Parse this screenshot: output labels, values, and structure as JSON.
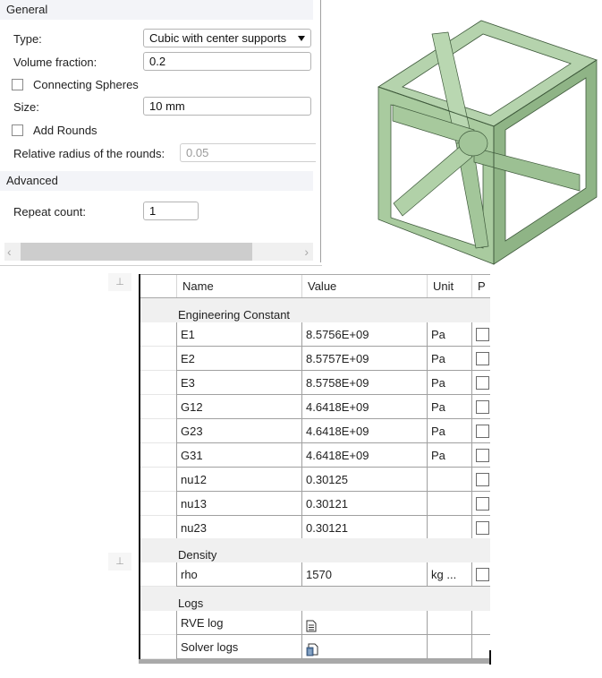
{
  "settings": {
    "general_header": "General",
    "type_label": "Type:",
    "type_value": "Cubic with center supports",
    "volume_fraction_label": "Volume fraction:",
    "volume_fraction_value": "0.2",
    "connecting_spheres_label": "Connecting Spheres",
    "connecting_spheres_checked": false,
    "size_label": "Size:",
    "size_value": "10 mm",
    "add_rounds_label": "Add Rounds",
    "add_rounds_checked": false,
    "round_radius_label": "Relative radius of the rounds:",
    "round_radius_value": "0.05",
    "advanced_header": "Advanced",
    "repeat_count_label": "Repeat count:",
    "repeat_count_value": "1",
    "scroll_left_icon": "chevron-left-icon",
    "scroll_right_icon": "chevron-right-icon"
  },
  "viewport": {
    "model": "cubic lattice unit cell with center supports",
    "model_color": "#a8c9a0"
  },
  "grid": {
    "columns": [
      "Name",
      "Value",
      "Unit",
      "P"
    ],
    "groups": [
      {
        "label": "Engineering Constant",
        "rows": [
          {
            "name": "E1",
            "value": "8.5756E+09",
            "unit": "Pa",
            "checked": false
          },
          {
            "name": "E2",
            "value": "8.5757E+09",
            "unit": "Pa",
            "checked": false
          },
          {
            "name": "E3",
            "value": "8.5758E+09",
            "unit": "Pa",
            "checked": false
          },
          {
            "name": "G12",
            "value": "4.6418E+09",
            "unit": "Pa",
            "checked": false
          },
          {
            "name": "G23",
            "value": "4.6418E+09",
            "unit": "Pa",
            "checked": false
          },
          {
            "name": "G31",
            "value": "4.6418E+09",
            "unit": "Pa",
            "checked": false
          },
          {
            "name": "nu12",
            "value": "0.30125",
            "unit": "",
            "checked": false
          },
          {
            "name": "nu13",
            "value": "0.30121",
            "unit": "",
            "checked": false
          },
          {
            "name": "nu23",
            "value": "0.30121",
            "unit": "",
            "checked": false
          }
        ]
      },
      {
        "label": "Density",
        "rows": [
          {
            "name": "rho",
            "value": "1570",
            "unit": "kg ...",
            "checked": false
          }
        ]
      },
      {
        "label": "Logs",
        "rows": [
          {
            "name": "RVE log",
            "value_icon": "document-icon",
            "unit": ""
          },
          {
            "name": "Solver logs",
            "value_icon": "documents-stack-icon",
            "unit": ""
          }
        ]
      }
    ],
    "pin_icon": "pin-icon"
  }
}
